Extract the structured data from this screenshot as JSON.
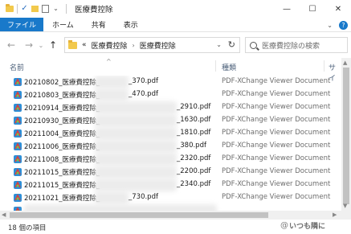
{
  "window": {
    "title": "医療費控除",
    "minimize_glyph": "—",
    "maximize_glyph": "☐",
    "close_glyph": "✕"
  },
  "ribbon": {
    "tabs": [
      "ファイル",
      "ホーム",
      "共有",
      "表示"
    ],
    "collapse_glyph": "⌄",
    "help_glyph": "?"
  },
  "nav": {
    "back_glyph": "←",
    "forward_glyph": "→",
    "recent_glyph": "⌄",
    "up_glyph": "↑",
    "overflow_glyph": "«",
    "breadcrumb": [
      "医療費控除",
      "医療費控除"
    ],
    "crumb_separator": "›",
    "dropdown_glyph": "⌄",
    "refresh_glyph": "↻"
  },
  "search": {
    "placeholder": "医療費控除の検索"
  },
  "columns": {
    "name": "名前",
    "type": "種類",
    "size": "サイ",
    "sort_glyph": "^"
  },
  "files": [
    {
      "name_start": "20210802_医療費控除_",
      "name_end": "_370.pdf",
      "type": "PDF-XChange Viewer Document"
    },
    {
      "name_start": "20210803_医療費控除_",
      "name_end": "_470.pdf",
      "type": "PDF-XChange Viewer Document"
    },
    {
      "name_start": "20210914_医療費控除_",
      "name_end": "_2910.pdf",
      "type": "PDF-XChange Viewer Document"
    },
    {
      "name_start": "20210930_医療費控除_",
      "name_end": "_1630.pdf",
      "type": "PDF-XChange Viewer Document"
    },
    {
      "name_start": "20211004_医療費控除_",
      "name_end": "_1810.pdf",
      "type": "PDF-XChange Viewer Document"
    },
    {
      "name_start": "20211006_医療費控除_",
      "name_end": "_380.pdf",
      "type": "PDF-XChange Viewer Document"
    },
    {
      "name_start": "20211008_医療費控除_",
      "name_end": "_2320.pdf",
      "type": "PDF-XChange Viewer Document"
    },
    {
      "name_start": "20211015_医療費控除_",
      "name_end": "_2200.pdf",
      "type": "PDF-XChange Viewer Document"
    },
    {
      "name_start": "20211015_医療費控除_",
      "name_end": "_2340.pdf",
      "type": "PDF-XChange Viewer Document"
    },
    {
      "name_start": "20211021_医療費控除_",
      "name_end": "_730.pdf",
      "type": "PDF-XChange Viewer Document"
    }
  ],
  "status": {
    "item_count": "18 個の項目"
  },
  "watermark": {
    "glyph": "@",
    "text": "いつも隣に"
  },
  "scroll": {
    "up_glyph": "▲",
    "down_glyph": "▼",
    "left_glyph": "◀",
    "right_glyph": "▶"
  }
}
